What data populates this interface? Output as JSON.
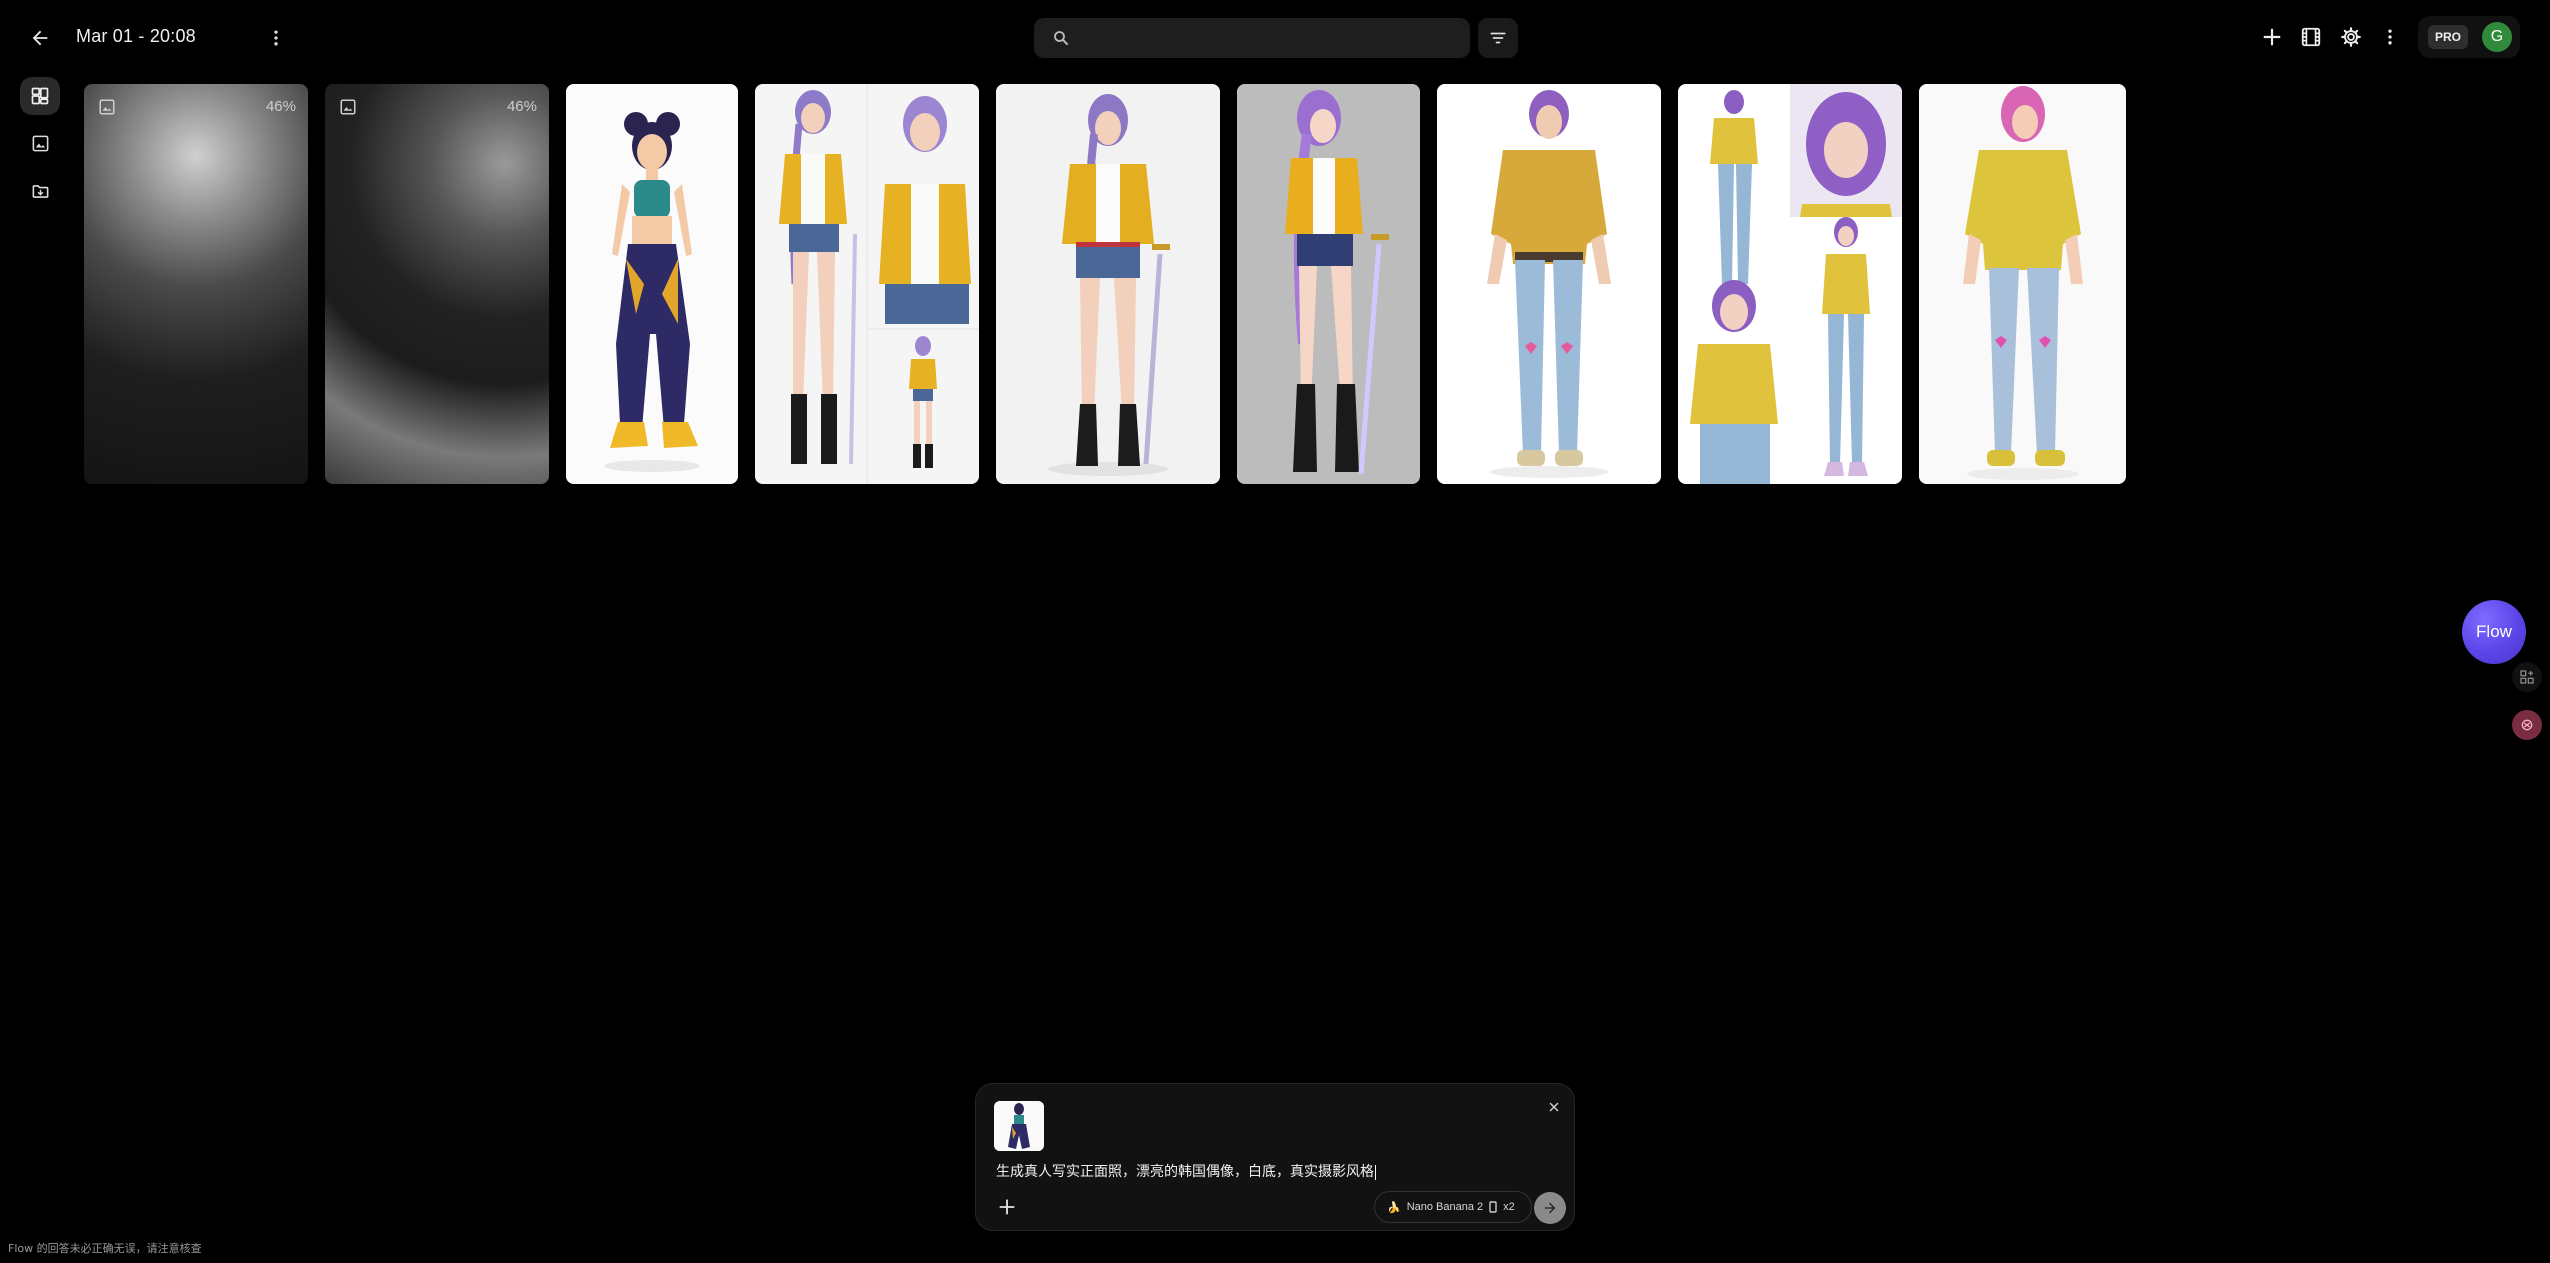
{
  "header": {
    "title": "Mar 01 - 20:08",
    "search_placeholder": "",
    "pro_label": "PRO",
    "avatar_initial": "G"
  },
  "icons": {
    "back": "arrow-left-icon",
    "menu": "more-vert-icon",
    "search": "search-icon",
    "filter": "filter-icon",
    "add": "plus-icon",
    "scenes": "film-icon",
    "settings": "gear-icon",
    "rail": [
      "grid-view-icon",
      "image-icon",
      "folder-move-icon"
    ]
  },
  "gallery": {
    "loading_tiles": [
      {
        "progress_label": "46%",
        "progress": 0.46
      },
      {
        "progress_label": "46%",
        "progress": 0.46
      }
    ],
    "images": [
      {
        "name": "cartoon-girl-navy-pants"
      },
      {
        "name": "idol-yellow-jacket-collage"
      },
      {
        "name": "idol-yellow-jacket-sword"
      },
      {
        "name": "idol-yellow-jacket-sword-gray-bg"
      },
      {
        "name": "purple-hair-yellow-shirt-jeans"
      },
      {
        "name": "purple-hair-yellow-shirt-collage"
      },
      {
        "name": "pink-hair-yellow-shirt-jeans"
      }
    ]
  },
  "flow": {
    "label": "Flow"
  },
  "composer": {
    "prompt": "生成真人写实正面照，漂亮的韩国偶像，白底，真实摄影风格",
    "model_emoji": "🍌",
    "model_name": "Nano Banana 2",
    "count": "x2"
  },
  "footer": {
    "disclaimer": "Flow 的回答未必正确无误，请注意核查"
  },
  "colors": {
    "background": "#000000",
    "flow_button": "#5b45e8",
    "avatar": "#2f8a3b"
  }
}
